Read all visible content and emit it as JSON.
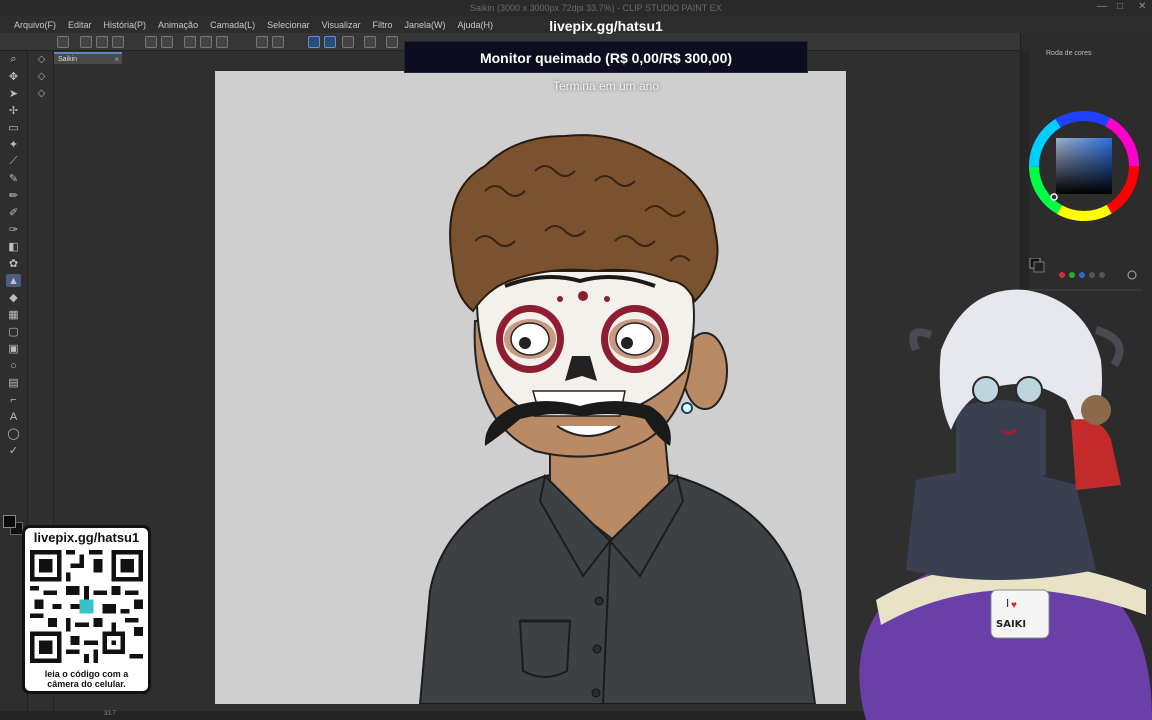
{
  "window": {
    "title": "Saikin (3000 x 3000px 72dpi 33.7%) - CLIP STUDIO PAINT EX",
    "controls": [
      "—",
      "□",
      "✕"
    ]
  },
  "menu": [
    "Arquivo(F)",
    "Editar",
    "História(P)",
    "Animação",
    "Camada(L)",
    "Selecionar",
    "Visualizar",
    "Filtro",
    "Janela(W)",
    "Ajuda(H)"
  ],
  "document": {
    "tab_label": "Saikin",
    "tab_close": "×",
    "zoom": "33.7"
  },
  "color_panel": {
    "label": "Roda de cores"
  },
  "overlay": {
    "pix_url_top": "livepix.gg/hatsu1",
    "goal_text": "Monitor queimado (R$ 0,00/R$ 300,00)",
    "goal_subtitle": "Termina em um ano",
    "qr_url": "livepix.gg/hatsu1",
    "qr_hint_line1": "leia o código com a",
    "qr_hint_line2": "câmera do celular."
  },
  "mug_text": {
    "line1": "I",
    "line2": "SAIKI"
  },
  "colors": {
    "accent": "#5b87c7",
    "canvas_bg": "#cfcfcf",
    "hair": "#7a5230",
    "skin": "#b98a64",
    "shirt": "#3d4144",
    "skull_red": "#8f1d32"
  }
}
